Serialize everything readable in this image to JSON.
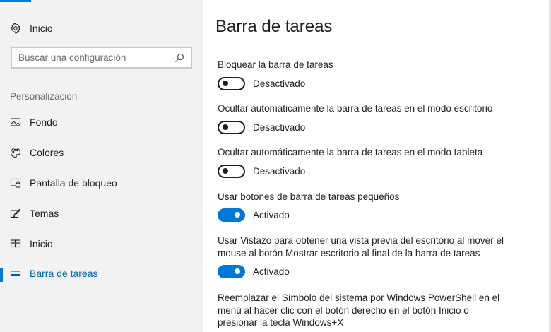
{
  "sidebar": {
    "home_label": "Inicio",
    "search": {
      "placeholder": "Buscar una configuración",
      "value": ""
    },
    "section_header": "Personalización",
    "items": [
      {
        "label": "Fondo",
        "icon": "picture-icon"
      },
      {
        "label": "Colores",
        "icon": "palette-icon"
      },
      {
        "label": "Pantalla de bloqueo",
        "icon": "lock-screen-icon"
      },
      {
        "label": "Temas",
        "icon": "themes-brush-icon"
      },
      {
        "label": "Inicio",
        "icon": "start-tiles-icon"
      },
      {
        "label": "Barra de tareas",
        "icon": "taskbar-icon",
        "selected": true
      }
    ]
  },
  "main": {
    "title": "Barra de tareas",
    "settings": [
      {
        "label": "Bloquear la barra de tareas",
        "state_label": "Desactivado",
        "on": false
      },
      {
        "label": "Ocultar automáticamente la barra de tareas en el modo escritorio",
        "state_label": "Desactivado",
        "on": false
      },
      {
        "label": "Ocultar automáticamente la barra de tareas en el modo tableta",
        "state_label": "Desactivado",
        "on": false
      },
      {
        "label": "Usar botones de barra de tareas pequeños",
        "state_label": "Activado",
        "on": true
      },
      {
        "label": "Usar Vistazo para obtener una vista previa del escritorio al mover el mouse al botón Mostrar escritorio al final de la barra de tareas",
        "state_label": "Activado",
        "on": true
      },
      {
        "label": "Reemplazar el Símbolo del sistema por Windows PowerShell en el menú al hacer clic con el botón derecho en el botón Inicio o presionar la tecla Windows+X"
      }
    ]
  },
  "colors": {
    "accent": "#0078d7",
    "sidebar_bg": "#f2f2f2",
    "selected_text": "#0063b1"
  }
}
